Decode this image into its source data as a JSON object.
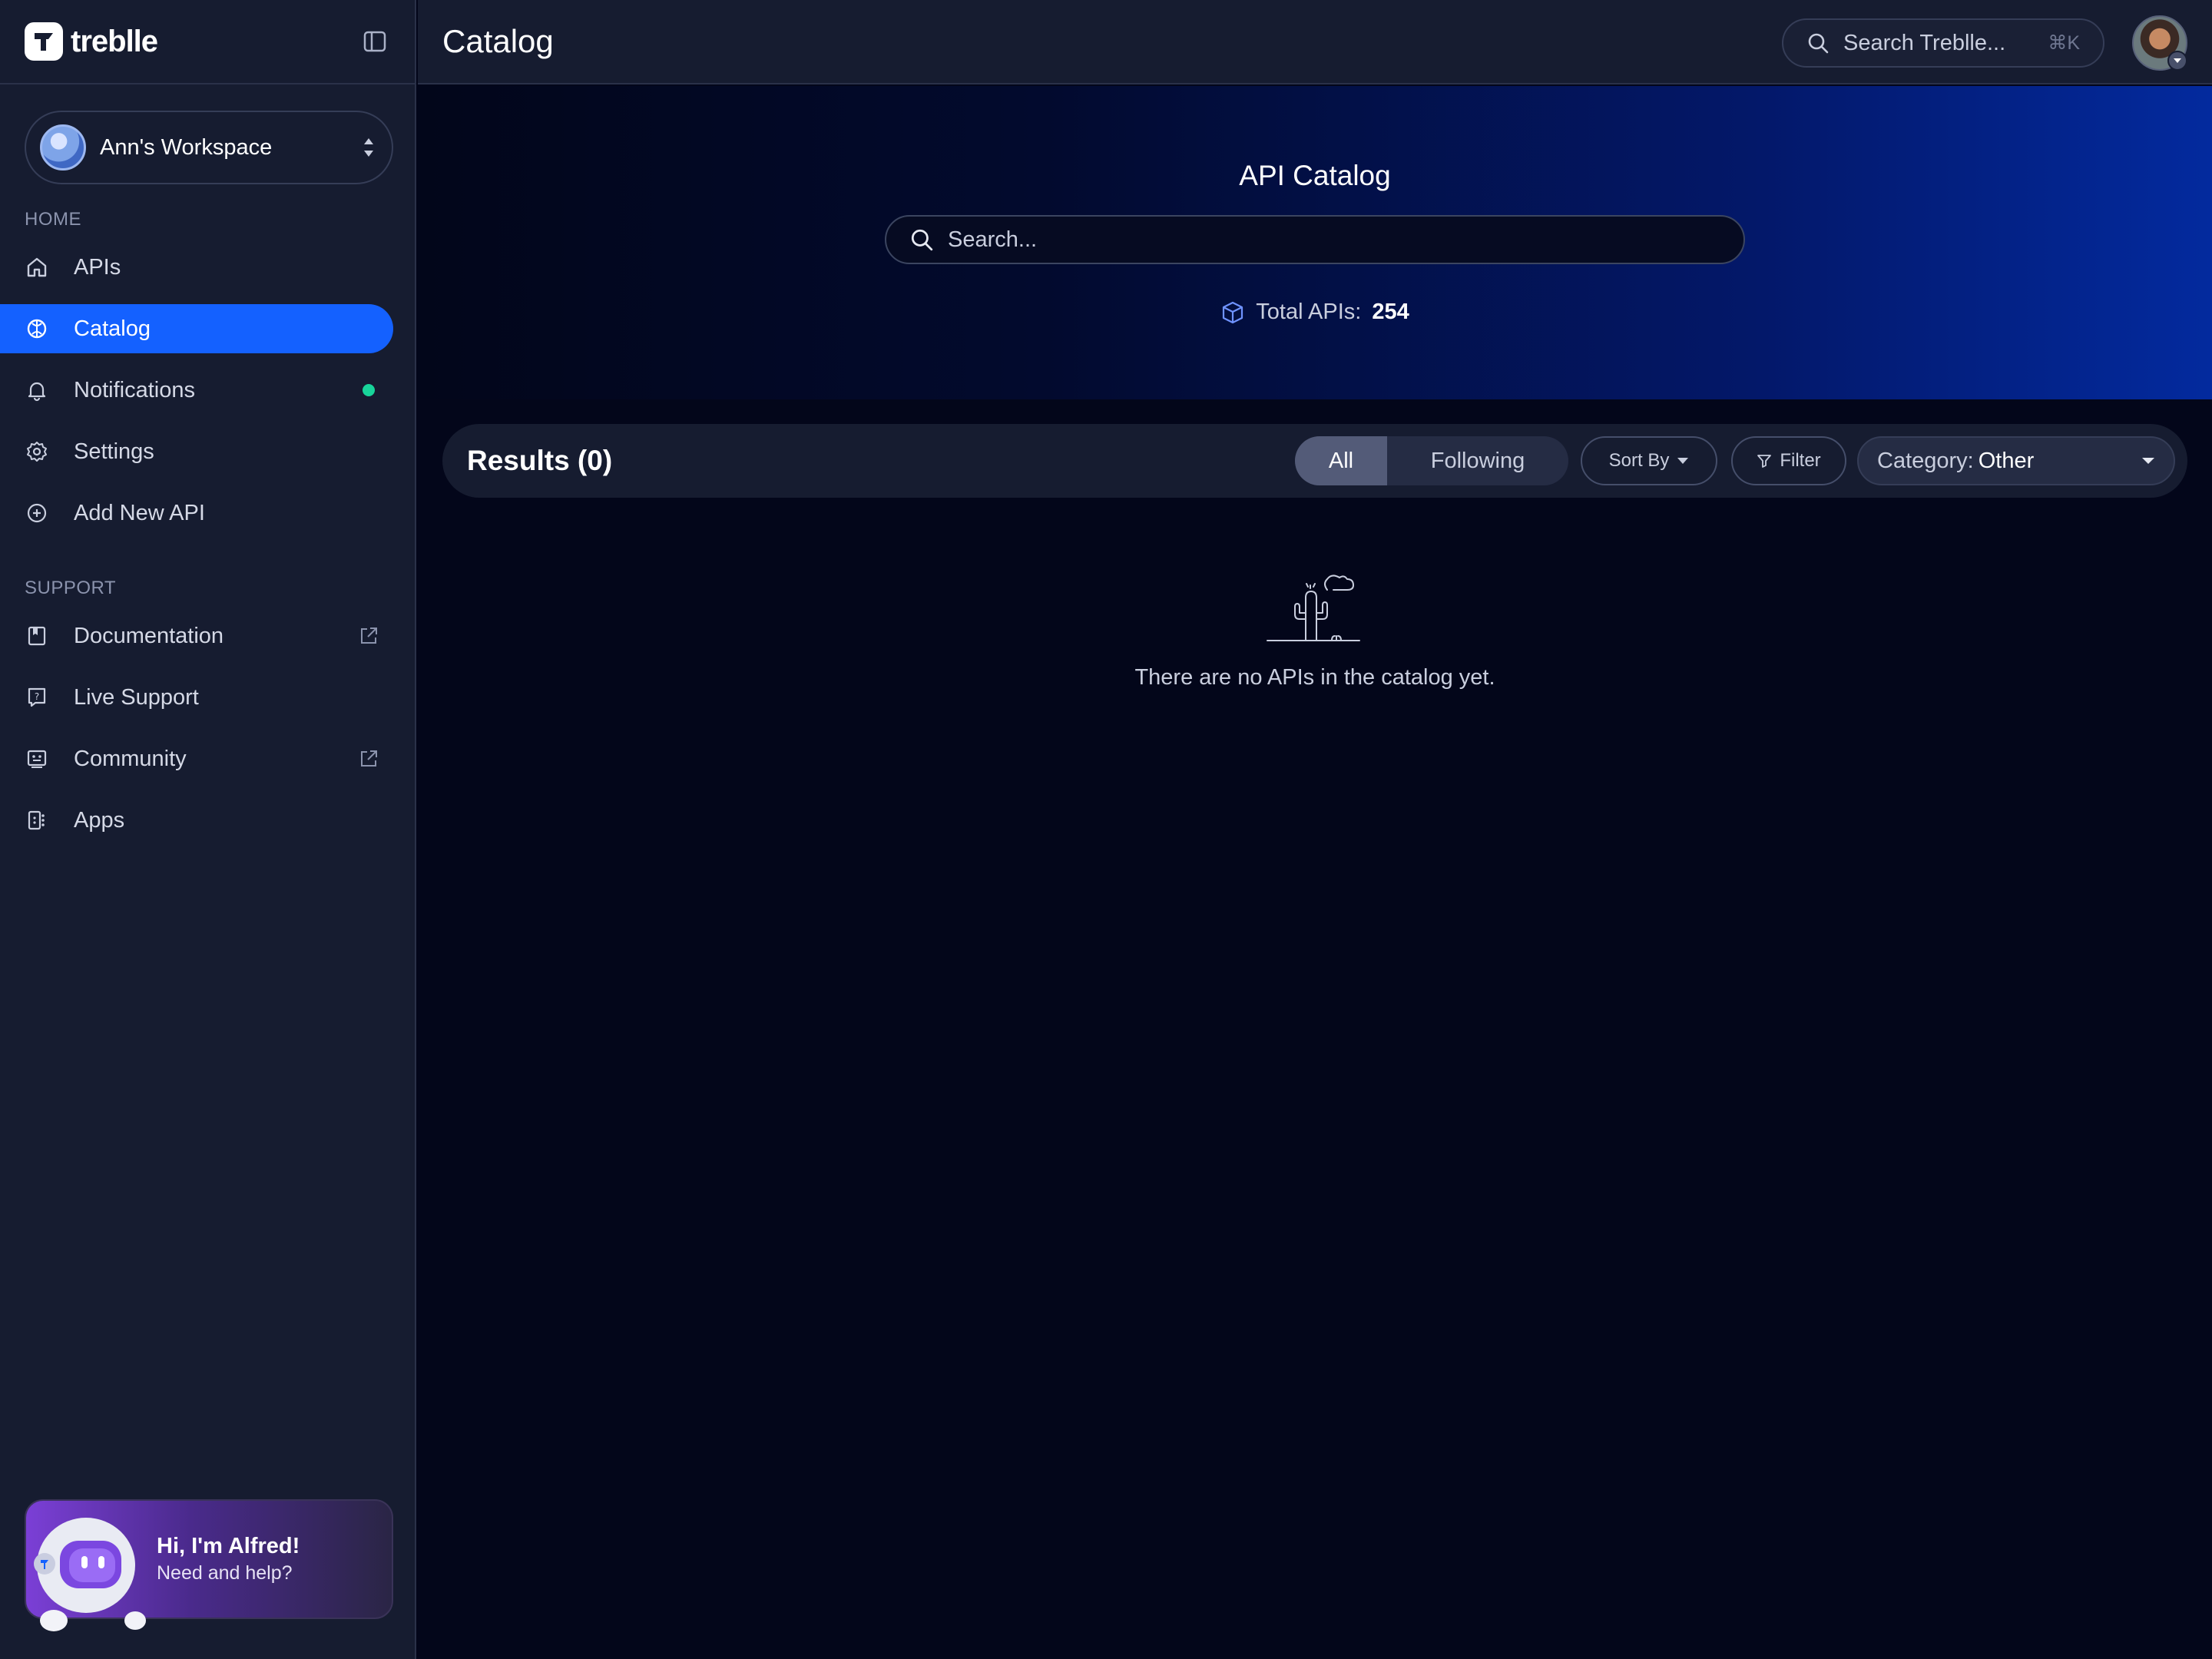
{
  "app": {
    "brand": "treblle",
    "page_title": "Catalog"
  },
  "sidebar": {
    "workspace": {
      "name": "Ann's Workspace"
    },
    "home_label": "HOME",
    "home_items": [
      {
        "label": "APIs",
        "icon": "home-icon"
      },
      {
        "label": "Catalog",
        "icon": "catalog-icon",
        "active": true
      },
      {
        "label": "Notifications",
        "icon": "bell-icon",
        "indicator": "unread-dot"
      },
      {
        "label": "Settings",
        "icon": "gear-icon"
      },
      {
        "label": "Add New API",
        "icon": "plus-circle-icon"
      }
    ],
    "support_label": "SUPPORT",
    "support_items": [
      {
        "label": "Documentation",
        "icon": "book-icon",
        "external": true
      },
      {
        "label": "Live Support",
        "icon": "help-chat-icon"
      },
      {
        "label": "Community",
        "icon": "community-icon",
        "external": true
      },
      {
        "label": "Apps",
        "icon": "apps-icon"
      }
    ],
    "assistant": {
      "title": "Hi, I'm Alfred!",
      "subtitle": "Need and help?"
    }
  },
  "topbar": {
    "search_label": "Search Treblle...",
    "search_shortcut": "⌘K"
  },
  "hero": {
    "title": "API Catalog",
    "search_placeholder": "Search...",
    "total_label": "Total APIs:",
    "total_count": "254"
  },
  "results": {
    "title": "Results (0)",
    "tabs": [
      {
        "label": "All",
        "selected": true
      },
      {
        "label": "Following",
        "selected": false
      }
    ],
    "sort_label": "Sort By",
    "filter_label": "Filter",
    "category_label": "Category:",
    "category_value": "Other",
    "empty_message": "There are no APIs in the catalog yet."
  },
  "colors": {
    "accent": "#1461ff",
    "sidebar_bg": "#161c30",
    "page_bg": "#03061a",
    "status_dot": "#18d49a"
  }
}
